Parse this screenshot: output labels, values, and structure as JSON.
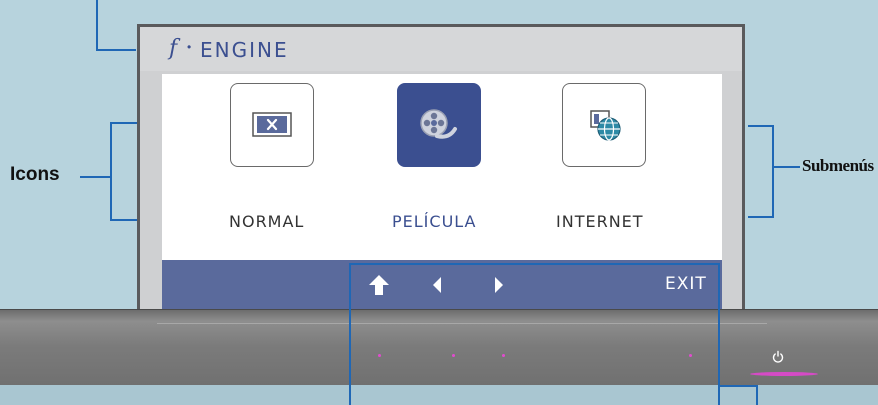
{
  "osd": {
    "brand_glyph": "f",
    "brand_separator": "•",
    "title": "ENGINE",
    "modes": [
      {
        "label": "NORMAL",
        "icon": "monitor-x-icon",
        "selected": false
      },
      {
        "label": "PELÍCULA",
        "icon": "film-reel-icon",
        "selected": true
      },
      {
        "label": "INTERNET",
        "icon": "web-globe-icon",
        "selected": false
      }
    ],
    "nav": {
      "up_icon": "up-arrow-icon",
      "left_icon": "left-arrow-icon",
      "right_icon": "right-arrow-icon",
      "exit_label": "EXIT"
    }
  },
  "callouts": {
    "icons_label": "Icons",
    "submenus_label": "Submenús"
  },
  "bezel": {
    "power_icon": "power-icon"
  },
  "colors": {
    "background": "#b7d3dd",
    "accent": "#3b4f90",
    "nav_bar": "#5a6a9c",
    "callout_line": "#1f67b5",
    "indicator_dot": "#e24bcf"
  }
}
